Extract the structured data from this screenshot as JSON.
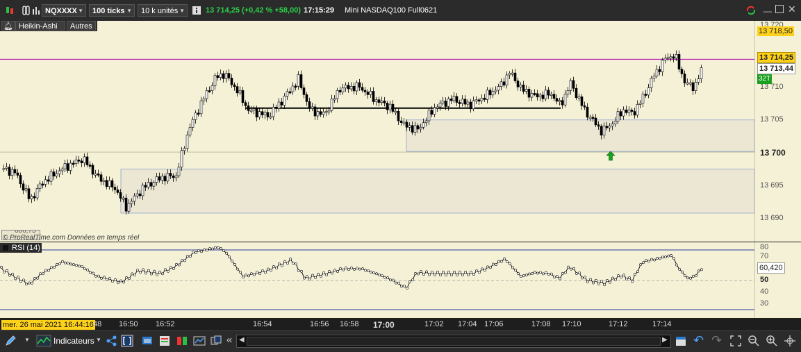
{
  "toolbar": {
    "ticker": "NQXXXX",
    "ticks": "100 ticks",
    "units": "10 k unités",
    "price_change": "13 714,25 (+0,42 % +58,00)",
    "time": "17:15:29",
    "instrument": "Mini NASDAQ100 Full0621"
  },
  "subbar": {
    "style_btn": "Heikin-Ashi",
    "other_btn": "Autres"
  },
  "price_axis": {
    "ticks": [
      "13 720",
      "13 710",
      "13 705",
      "13 700",
      "13 695",
      "13 690"
    ],
    "label_high": "13 718,50",
    "label_last": "13 714,25",
    "label_prev": "13 713,44",
    "label_tag": "32T"
  },
  "chart": {
    "watermark": "© ProRealTime.com  Données en temps réel",
    "clip_label": "686,75",
    "colors": {
      "bg": "#f5f1d6",
      "up": "#ffffff",
      "down": "#000000",
      "magenta": "#b000b0",
      "zone": "#8da0d0",
      "arrow": "#1aa020"
    }
  },
  "rsi": {
    "title": "RSI (14)",
    "ticks": [
      "80",
      "70",
      "50",
      "40",
      "30"
    ],
    "value": "60,420"
  },
  "time_axis": {
    "date": "mer. 26 mai 2021 16:44:16",
    "labels": [
      "48",
      "16:50",
      "16:52",
      "16:54",
      "16:56",
      "16:58",
      "17:00",
      "17:02",
      "17:04",
      "17:06",
      "17:08",
      "17:10",
      "17:12",
      "17:14"
    ]
  },
  "bottom": {
    "indicators": "Indicateurs"
  }
}
